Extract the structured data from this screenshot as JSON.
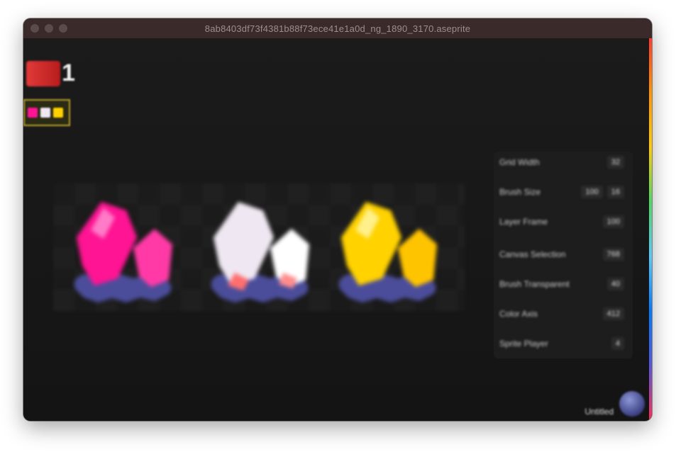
{
  "window": {
    "title": "8ab8403df73f4381b88f73ece41e1a0d_ng_1890_3170.aseprite"
  },
  "app": {
    "logo_number": "1"
  },
  "panel": {
    "rows": [
      {
        "label": "Grid Width",
        "value": "32"
      },
      {
        "label": "Brush Size",
        "value": "16",
        "value2": "100"
      },
      {
        "label": "Layer Frame",
        "value": "100"
      },
      {
        "label": "Canvas Selection",
        "value": "768"
      },
      {
        "label": "Brush Transparent",
        "value": "40"
      },
      {
        "label": "Color Axis",
        "value": "412"
      },
      {
        "label": "Sprite Player",
        "value": "4"
      }
    ]
  },
  "footer": {
    "label": "Untitled"
  },
  "colors": {
    "accent_magenta": "#ff1493",
    "accent_white": "#efe7f1",
    "accent_yellow": "#ffd200",
    "rock_blue": "#4b4d9a"
  },
  "icons": {
    "palette_icons": [
      "palette-swatch-magenta",
      "palette-swatch-white",
      "palette-swatch-yellow"
    ]
  }
}
